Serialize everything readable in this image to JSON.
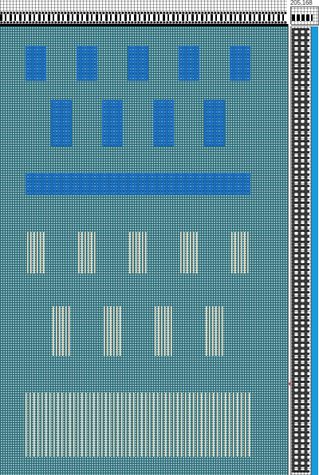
{
  "header": {
    "counter_text": "205,168"
  },
  "colors": {
    "ground": "#2b6a75",
    "dots": "#9bc3c9",
    "blue_motif": "#1a6fc0",
    "tan_motif": "#f2dfc2",
    "weft_color_bar": "#1a9ad6",
    "marker": "#dd3333"
  },
  "footer": {
    "watermark": ""
  }
}
